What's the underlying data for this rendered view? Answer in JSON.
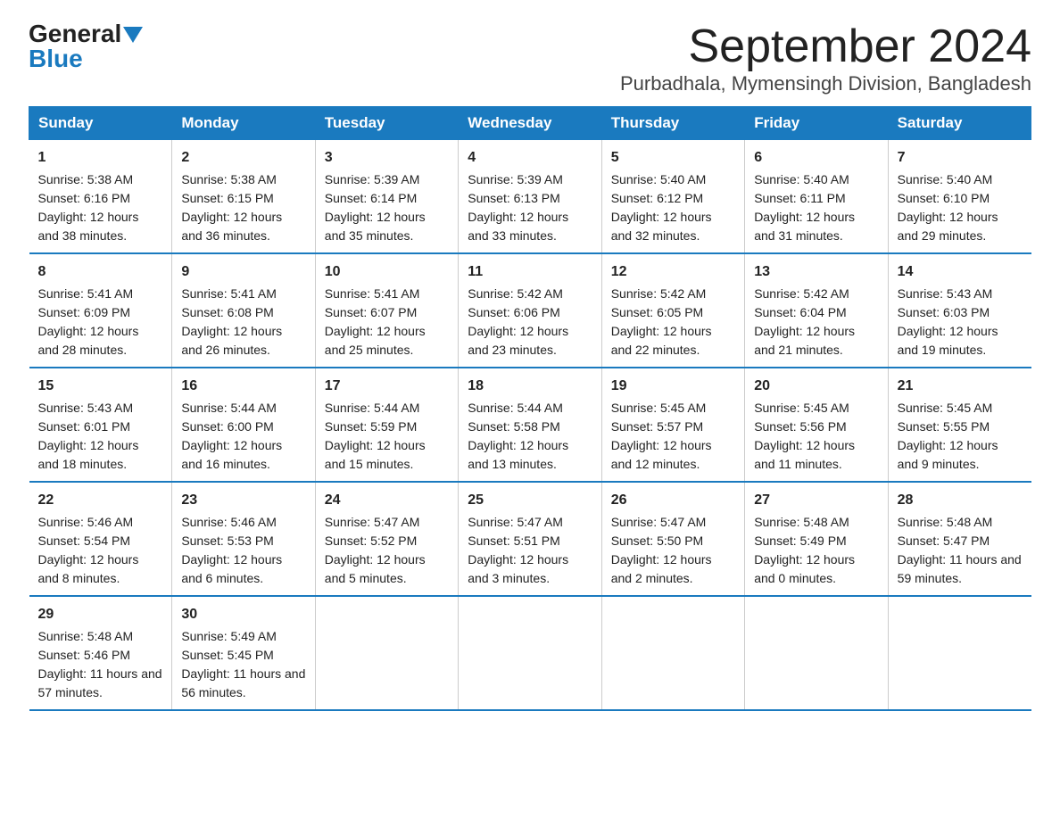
{
  "header": {
    "logo_general": "General",
    "logo_blue": "Blue",
    "month_title": "September 2024",
    "subtitle": "Purbadhala, Mymensingh Division, Bangladesh"
  },
  "calendar": {
    "days_of_week": [
      "Sunday",
      "Monday",
      "Tuesday",
      "Wednesday",
      "Thursday",
      "Friday",
      "Saturday"
    ],
    "weeks": [
      [
        {
          "num": "1",
          "sunrise": "5:38 AM",
          "sunset": "6:16 PM",
          "daylight": "12 hours and 38 minutes."
        },
        {
          "num": "2",
          "sunrise": "5:38 AM",
          "sunset": "6:15 PM",
          "daylight": "12 hours and 36 minutes."
        },
        {
          "num": "3",
          "sunrise": "5:39 AM",
          "sunset": "6:14 PM",
          "daylight": "12 hours and 35 minutes."
        },
        {
          "num": "4",
          "sunrise": "5:39 AM",
          "sunset": "6:13 PM",
          "daylight": "12 hours and 33 minutes."
        },
        {
          "num": "5",
          "sunrise": "5:40 AM",
          "sunset": "6:12 PM",
          "daylight": "12 hours and 32 minutes."
        },
        {
          "num": "6",
          "sunrise": "5:40 AM",
          "sunset": "6:11 PM",
          "daylight": "12 hours and 31 minutes."
        },
        {
          "num": "7",
          "sunrise": "5:40 AM",
          "sunset": "6:10 PM",
          "daylight": "12 hours and 29 minutes."
        }
      ],
      [
        {
          "num": "8",
          "sunrise": "5:41 AM",
          "sunset": "6:09 PM",
          "daylight": "12 hours and 28 minutes."
        },
        {
          "num": "9",
          "sunrise": "5:41 AM",
          "sunset": "6:08 PM",
          "daylight": "12 hours and 26 minutes."
        },
        {
          "num": "10",
          "sunrise": "5:41 AM",
          "sunset": "6:07 PM",
          "daylight": "12 hours and 25 minutes."
        },
        {
          "num": "11",
          "sunrise": "5:42 AM",
          "sunset": "6:06 PM",
          "daylight": "12 hours and 23 minutes."
        },
        {
          "num": "12",
          "sunrise": "5:42 AM",
          "sunset": "6:05 PM",
          "daylight": "12 hours and 22 minutes."
        },
        {
          "num": "13",
          "sunrise": "5:42 AM",
          "sunset": "6:04 PM",
          "daylight": "12 hours and 21 minutes."
        },
        {
          "num": "14",
          "sunrise": "5:43 AM",
          "sunset": "6:03 PM",
          "daylight": "12 hours and 19 minutes."
        }
      ],
      [
        {
          "num": "15",
          "sunrise": "5:43 AM",
          "sunset": "6:01 PM",
          "daylight": "12 hours and 18 minutes."
        },
        {
          "num": "16",
          "sunrise": "5:44 AM",
          "sunset": "6:00 PM",
          "daylight": "12 hours and 16 minutes."
        },
        {
          "num": "17",
          "sunrise": "5:44 AM",
          "sunset": "5:59 PM",
          "daylight": "12 hours and 15 minutes."
        },
        {
          "num": "18",
          "sunrise": "5:44 AM",
          "sunset": "5:58 PM",
          "daylight": "12 hours and 13 minutes."
        },
        {
          "num": "19",
          "sunrise": "5:45 AM",
          "sunset": "5:57 PM",
          "daylight": "12 hours and 12 minutes."
        },
        {
          "num": "20",
          "sunrise": "5:45 AM",
          "sunset": "5:56 PM",
          "daylight": "12 hours and 11 minutes."
        },
        {
          "num": "21",
          "sunrise": "5:45 AM",
          "sunset": "5:55 PM",
          "daylight": "12 hours and 9 minutes."
        }
      ],
      [
        {
          "num": "22",
          "sunrise": "5:46 AM",
          "sunset": "5:54 PM",
          "daylight": "12 hours and 8 minutes."
        },
        {
          "num": "23",
          "sunrise": "5:46 AM",
          "sunset": "5:53 PM",
          "daylight": "12 hours and 6 minutes."
        },
        {
          "num": "24",
          "sunrise": "5:47 AM",
          "sunset": "5:52 PM",
          "daylight": "12 hours and 5 minutes."
        },
        {
          "num": "25",
          "sunrise": "5:47 AM",
          "sunset": "5:51 PM",
          "daylight": "12 hours and 3 minutes."
        },
        {
          "num": "26",
          "sunrise": "5:47 AM",
          "sunset": "5:50 PM",
          "daylight": "12 hours and 2 minutes."
        },
        {
          "num": "27",
          "sunrise": "5:48 AM",
          "sunset": "5:49 PM",
          "daylight": "12 hours and 0 minutes."
        },
        {
          "num": "28",
          "sunrise": "5:48 AM",
          "sunset": "5:47 PM",
          "daylight": "11 hours and 59 minutes."
        }
      ],
      [
        {
          "num": "29",
          "sunrise": "5:48 AM",
          "sunset": "5:46 PM",
          "daylight": "11 hours and 57 minutes."
        },
        {
          "num": "30",
          "sunrise": "5:49 AM",
          "sunset": "5:45 PM",
          "daylight": "11 hours and 56 minutes."
        },
        {
          "num": "",
          "sunrise": "",
          "sunset": "",
          "daylight": ""
        },
        {
          "num": "",
          "sunrise": "",
          "sunset": "",
          "daylight": ""
        },
        {
          "num": "",
          "sunrise": "",
          "sunset": "",
          "daylight": ""
        },
        {
          "num": "",
          "sunrise": "",
          "sunset": "",
          "daylight": ""
        },
        {
          "num": "",
          "sunrise": "",
          "sunset": "",
          "daylight": ""
        }
      ]
    ],
    "labels": {
      "sunrise": "Sunrise:",
      "sunset": "Sunset:",
      "daylight": "Daylight:"
    }
  }
}
